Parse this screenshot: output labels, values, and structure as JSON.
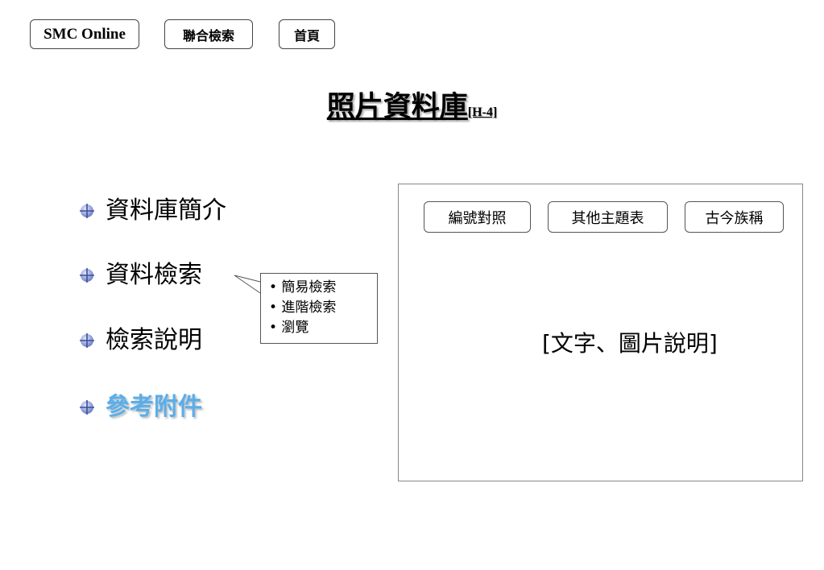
{
  "nav": {
    "smc_online": "SMC Online",
    "union_search": "聯合檢索",
    "home": "首頁"
  },
  "title": {
    "main": "照片資料庫",
    "code": "[H-4]"
  },
  "menu": {
    "items": [
      {
        "label": "資料庫簡介"
      },
      {
        "label": "資料檢索"
      },
      {
        "label": "檢索說明"
      },
      {
        "label": "參考附件",
        "active": true
      }
    ],
    "active_color": "#5aaeea"
  },
  "search_popup": {
    "options": [
      "• 簡易檢索",
      "• 進階檢索",
      "• 瀏覽"
    ]
  },
  "panel": {
    "buttons": [
      "編號對照",
      "其他主題表",
      "古今族稱"
    ],
    "description": "[文字、圖片說明]"
  }
}
